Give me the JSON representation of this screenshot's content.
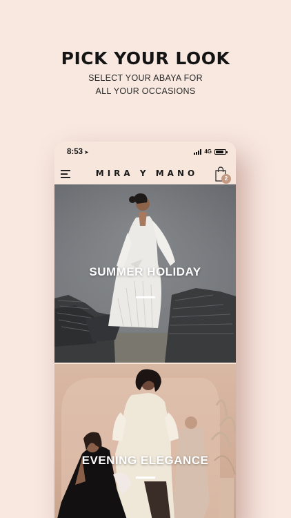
{
  "promo": {
    "title": "PICK YOUR LOOK",
    "subtitle_line1": "SELECT YOUR ABAYA FOR",
    "subtitle_line2": "ALL YOUR OCCASIONS"
  },
  "status_bar": {
    "time": "8:53",
    "network": "4G"
  },
  "header": {
    "brand": "MIRA Y MANO",
    "menu_icon": "hamburger-menu-icon",
    "cart_icon": "shopping-bag-icon",
    "cart_count": "2"
  },
  "banners": [
    {
      "title": "SUMMER HOLIDAY"
    },
    {
      "title": "EVENING ELEGANCE"
    }
  ],
  "colors": {
    "background": "#f8e8e0",
    "phone_background": "#f7e6dc",
    "badge": "#c49a82",
    "text_dark": "#141414"
  }
}
